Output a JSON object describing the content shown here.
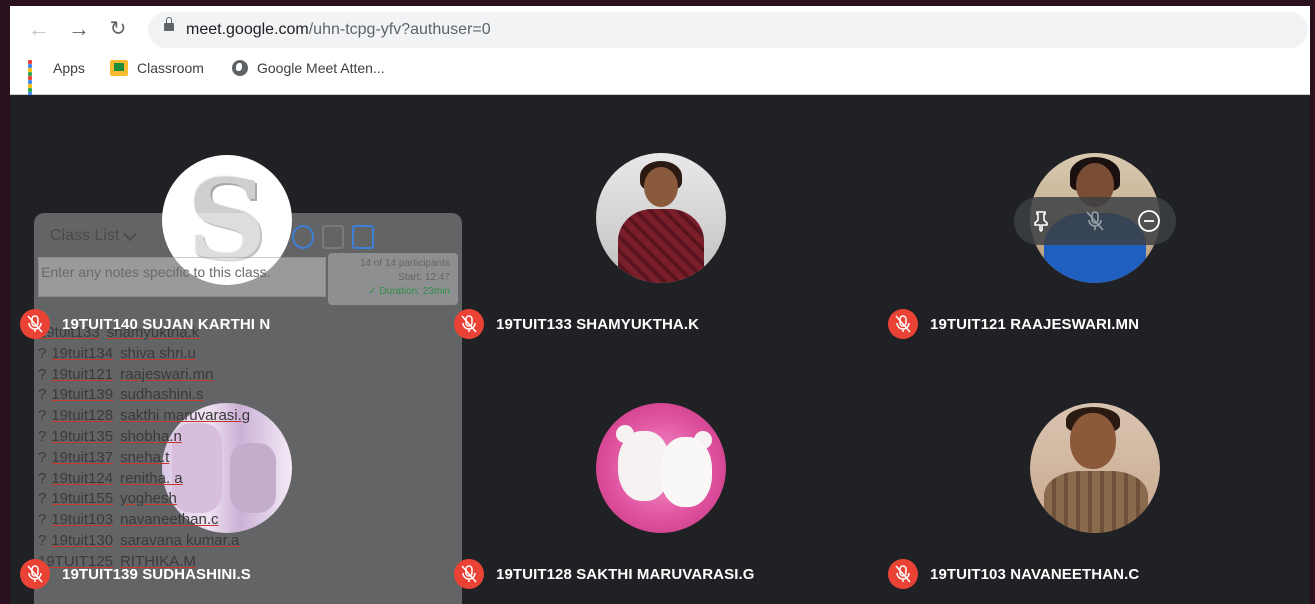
{
  "browser": {
    "url_host": "meet.google.com",
    "url_rest": "/uhn-tcpg-yfv?authuser=0",
    "bookmarks": [
      {
        "label": "Apps",
        "icon": "apps-grid-icon"
      },
      {
        "label": "Classroom",
        "icon": "classroom-icon"
      },
      {
        "label": "Google Meet Atten...",
        "icon": "globe-icon"
      }
    ]
  },
  "participants": [
    {
      "name": "19TUIT140 SUJAN KARTHI N",
      "avatar": "letter-s-avatar",
      "muted": true
    },
    {
      "name": "19TUIT133 SHAMYUKTHA.K",
      "avatar": "photo-avatar",
      "muted": true
    },
    {
      "name": "19TUIT121 RAAJESWARI.MN",
      "avatar": "photo-avatar",
      "muted": true
    },
    {
      "name": "19TUIT139 SUDHASHINI.S",
      "avatar": "collage-avatar",
      "muted": true
    },
    {
      "name": "19TUIT128 SAKTHI MARUVARASI.G",
      "avatar": "bears-avatar",
      "muted": true
    },
    {
      "name": "19TUIT103 NAVANEETHAN.C",
      "avatar": "photo-avatar",
      "muted": true
    }
  ],
  "hover_controls": [
    "pin-icon",
    "mute-icon",
    "remove-icon"
  ],
  "attendance_panel": {
    "class_dropdown": "Class List",
    "notes_placeholder": "Enter any notes specific to this class.",
    "stats": {
      "participants": "14 of 14 participants",
      "start": "Start: 12:47",
      "duration": "✓ Duration: 23min"
    },
    "rows": [
      {
        "id": "19tuit133",
        "name": "shamyuktha.k",
        "mark": ""
      },
      {
        "id": "19tuit134",
        "name": "shiva shri.u",
        "mark": "?"
      },
      {
        "id": "19tuit121",
        "name": "raajeswari.mn",
        "mark": "?"
      },
      {
        "id": "19tuit139",
        "name": "sudhashini.s",
        "mark": "?"
      },
      {
        "id": "19tuit128",
        "name": "sakthi maruvarasi.g",
        "mark": "?"
      },
      {
        "id": "19tuit135",
        "name": "shobha.n",
        "mark": "?"
      },
      {
        "id": "19tuit137",
        "name": "sneha.t",
        "mark": "?"
      },
      {
        "id": "19tuit124",
        "name": "renitha. a",
        "mark": "?"
      },
      {
        "id": "19tuit155",
        "name": "yoghesh",
        "mark": "?"
      },
      {
        "id": "19tuit103",
        "name": "navaneethan.c",
        "mark": "?"
      },
      {
        "id": "19tuit130",
        "name": "saravana kumar.a",
        "mark": "?"
      },
      {
        "id": "19TUIT125",
        "name": "RITHIKA.M",
        "mark": ""
      }
    ]
  },
  "colors": {
    "stage_bg": "#202124",
    "mic_muted": "#ea4335",
    "frame_bg": "#2a0f1e"
  }
}
